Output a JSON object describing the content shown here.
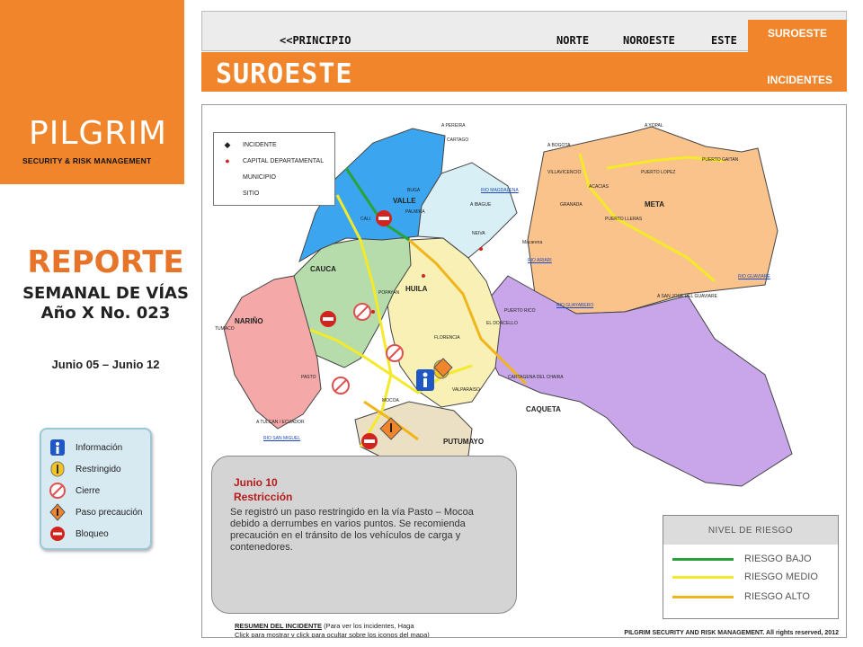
{
  "brand": {
    "logo": "PILGRIM",
    "tagline": "SECURITY & RISK MANAGEMENT"
  },
  "report": {
    "title": "REPORTE",
    "subtitle": "SEMANAL DE VÍAS",
    "issue": "Año X No. 023",
    "dates": "Junio 05 – Junio 12"
  },
  "legend": [
    {
      "label": "Información",
      "icon": "info-icon",
      "color": "#1f57c7"
    },
    {
      "label": "Restringido",
      "icon": "restricted-icon",
      "color": "#f5c51f"
    },
    {
      "label": "Cierre",
      "icon": "closure-icon",
      "color": "#e05050"
    },
    {
      "label": "Paso precaución",
      "icon": "caution-icon",
      "color": "#f0852b"
    },
    {
      "label": "Bloqueo",
      "icon": "stop-icon",
      "color": "#d2231f"
    }
  ],
  "nav": {
    "home": "<<PRINCIPIO",
    "north": "NORTE",
    "northwest": "NOROESTE",
    "east": "ESTE",
    "active": "SUROESTE"
  },
  "header": {
    "title": "SUROESTE",
    "incidents": "INCIDENTES"
  },
  "map": {
    "legend": [
      {
        "label": "INCIDENTE",
        "icon": "diamond-icon"
      },
      {
        "label": "CAPITAL DEPARTAMENTAL",
        "icon": "capital-dot-icon"
      },
      {
        "label": "MUNICIPIO",
        "icon": ""
      },
      {
        "label": "SITIO",
        "icon": ""
      }
    ],
    "departments": {
      "valle": "VALLE",
      "cauca": "CAUCA",
      "narino": "NARIÑO",
      "huila": "HUILA",
      "meta": "META",
      "caqueta": "CAQUETA",
      "putumayo": "PUTUMAYO"
    },
    "cities": {
      "pereira": "A PEREIRA",
      "yopal": "A YOPAL",
      "bogota": "A BOGOTA",
      "villavicencio": "VILLAVICENCIO",
      "puerto_gaitan": "PUERTO GAITAN",
      "puerto_lopez": "PUERTO LOPEZ",
      "acacias": "ACACIAS",
      "granada": "GRANADA",
      "puerto_lleras": "PUERTO LLERAS",
      "macarena": "Macarena",
      "puerto_rico": "PUERTO RICO",
      "san_jose": "A SAN JOSE DEL GUAVIARE",
      "el_doncello": "EL DONCELLO",
      "cartagena_chaira": "CARTAGENA DEL CHAIRA",
      "valparaiso": "VALPARAISO",
      "tumaco": "TUMACO",
      "ipiales": "A TULCAN / ECUADOR",
      "florencia": "FLORENCIA",
      "neiva": "NEIVA",
      "cartago": "CARTAGO",
      "ibague": "A IBAGUE",
      "buga": "BUGA",
      "palmira": "PALMIRA",
      "cali": "CALI",
      "popayan": "POPAYAN",
      "pasto": "PASTO",
      "mocoa": "MOCOA"
    },
    "rivers": {
      "magdalena": "RIO MAGDALENA",
      "ariari": "RIO ARIARI",
      "guaviare": "RIO GUAVIARE",
      "guayabero": "RIO GUAYABERO",
      "san_miguel": "RIO SAN MIGUEL"
    }
  },
  "incident": {
    "date": "Junio 10",
    "type": "Restricción",
    "text": "Se registró un paso restringido en la vía Pasto – Mocoa debido a derrumbes en varios puntos. Se recomienda precaución en el tránsito de los vehículos de carga y contenedores."
  },
  "summary": {
    "title": "RESUMEN DEL INCIDENTE",
    "hint": "(Para ver los incidentes, Haga",
    "hint2": "Click para mostrar y click para ocultar sobre los iconos del mapa)"
  },
  "risk": {
    "title": "NIVEL DE RIESGO",
    "levels": [
      {
        "label": "RIESGO BAJO",
        "color": "#27a33a"
      },
      {
        "label": "RIESGO MEDIO",
        "color": "#f4ea2a"
      },
      {
        "label": "RIESGO ALTO",
        "color": "#f0b51c"
      }
    ]
  },
  "footer": {
    "copyright": "PILGRIM SECURITY AND RISK MANAGEMENT. All rights reserved, 2012"
  }
}
